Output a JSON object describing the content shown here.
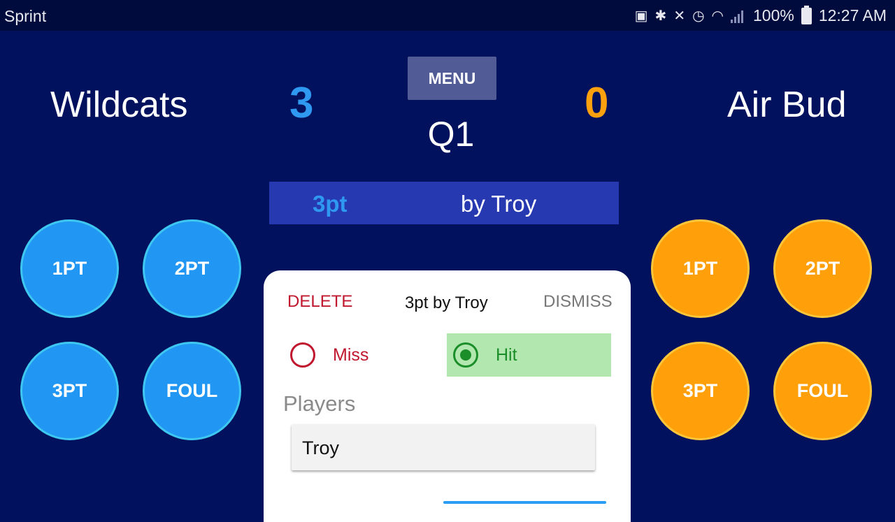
{
  "status_bar": {
    "carrier": "Sprint",
    "battery": "100%",
    "time": "12:27 AM",
    "icons": [
      "battery-saver-icon",
      "bluetooth-icon",
      "mute-icon",
      "alarm-icon",
      "wifi-icon",
      "signal-icon",
      "battery-icon"
    ]
  },
  "scoreboard": {
    "home_team": "Wildcats",
    "home_score": "3",
    "away_team": "Air Bud",
    "away_score": "0",
    "menu_label": "MENU",
    "quarter": "Q1"
  },
  "last_play": {
    "type": "3pt",
    "by": "by Troy"
  },
  "home_buttons": [
    "1PT",
    "2PT",
    "3PT",
    "FOUL"
  ],
  "away_buttons": [
    "1PT",
    "2PT",
    "3PT",
    "FOUL"
  ],
  "dialog": {
    "delete_label": "DELETE",
    "title": "3pt by Troy",
    "dismiss_label": "DISMISS",
    "miss_label": "Miss",
    "hit_label": "Hit",
    "selected": "Hit",
    "players_label": "Players",
    "player_value": "Troy"
  },
  "colors": {
    "background": "#01115e",
    "home_accent": "#2196f3",
    "away_accent": "#ffa00a",
    "hit_bg": "#b2e8b0",
    "delete": "#c0172f"
  }
}
